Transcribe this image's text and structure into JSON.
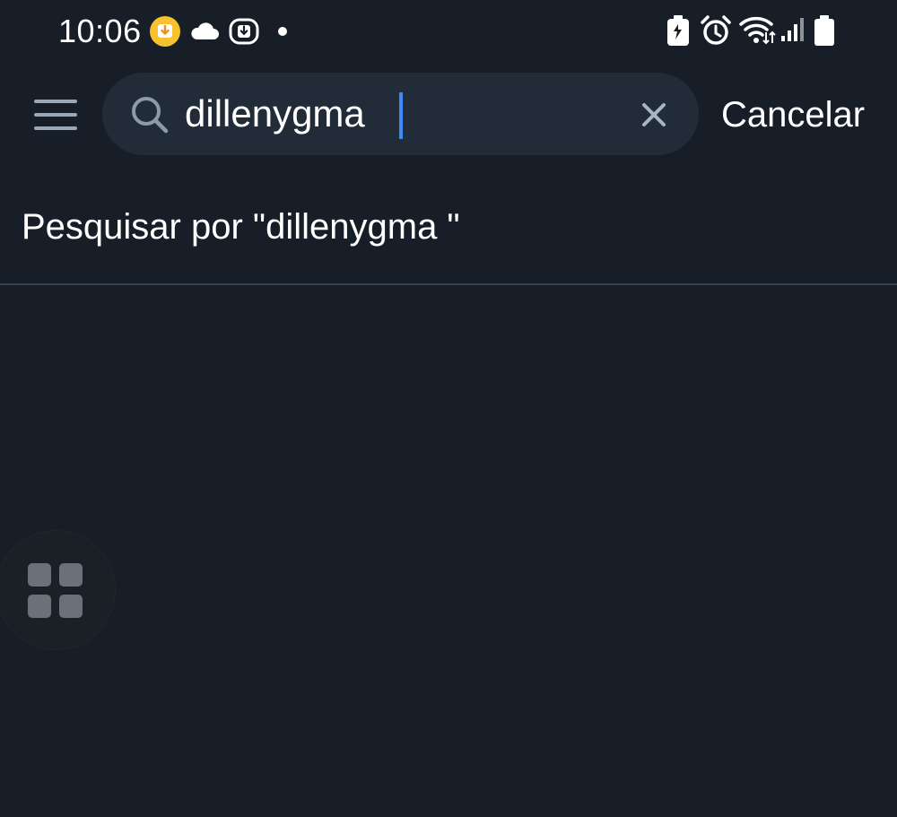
{
  "status_bar": {
    "time": "10:06",
    "left_icons": [
      "download-app-icon",
      "cloud-icon",
      "download-badge-icon",
      "notification-dot-icon"
    ],
    "right_icons": [
      "battery-saver-icon",
      "alarm-icon",
      "wifi-icon",
      "signal-icon",
      "battery-icon"
    ]
  },
  "search": {
    "query": "dillenygma",
    "cancel_label": "Cancelar"
  },
  "suggestion": {
    "text": "Pesquisar por \"dillenygma \""
  },
  "colors": {
    "background": "#171e27",
    "search_box": "#222c38",
    "caret": "#3d8af7",
    "divider": "#33404d"
  }
}
